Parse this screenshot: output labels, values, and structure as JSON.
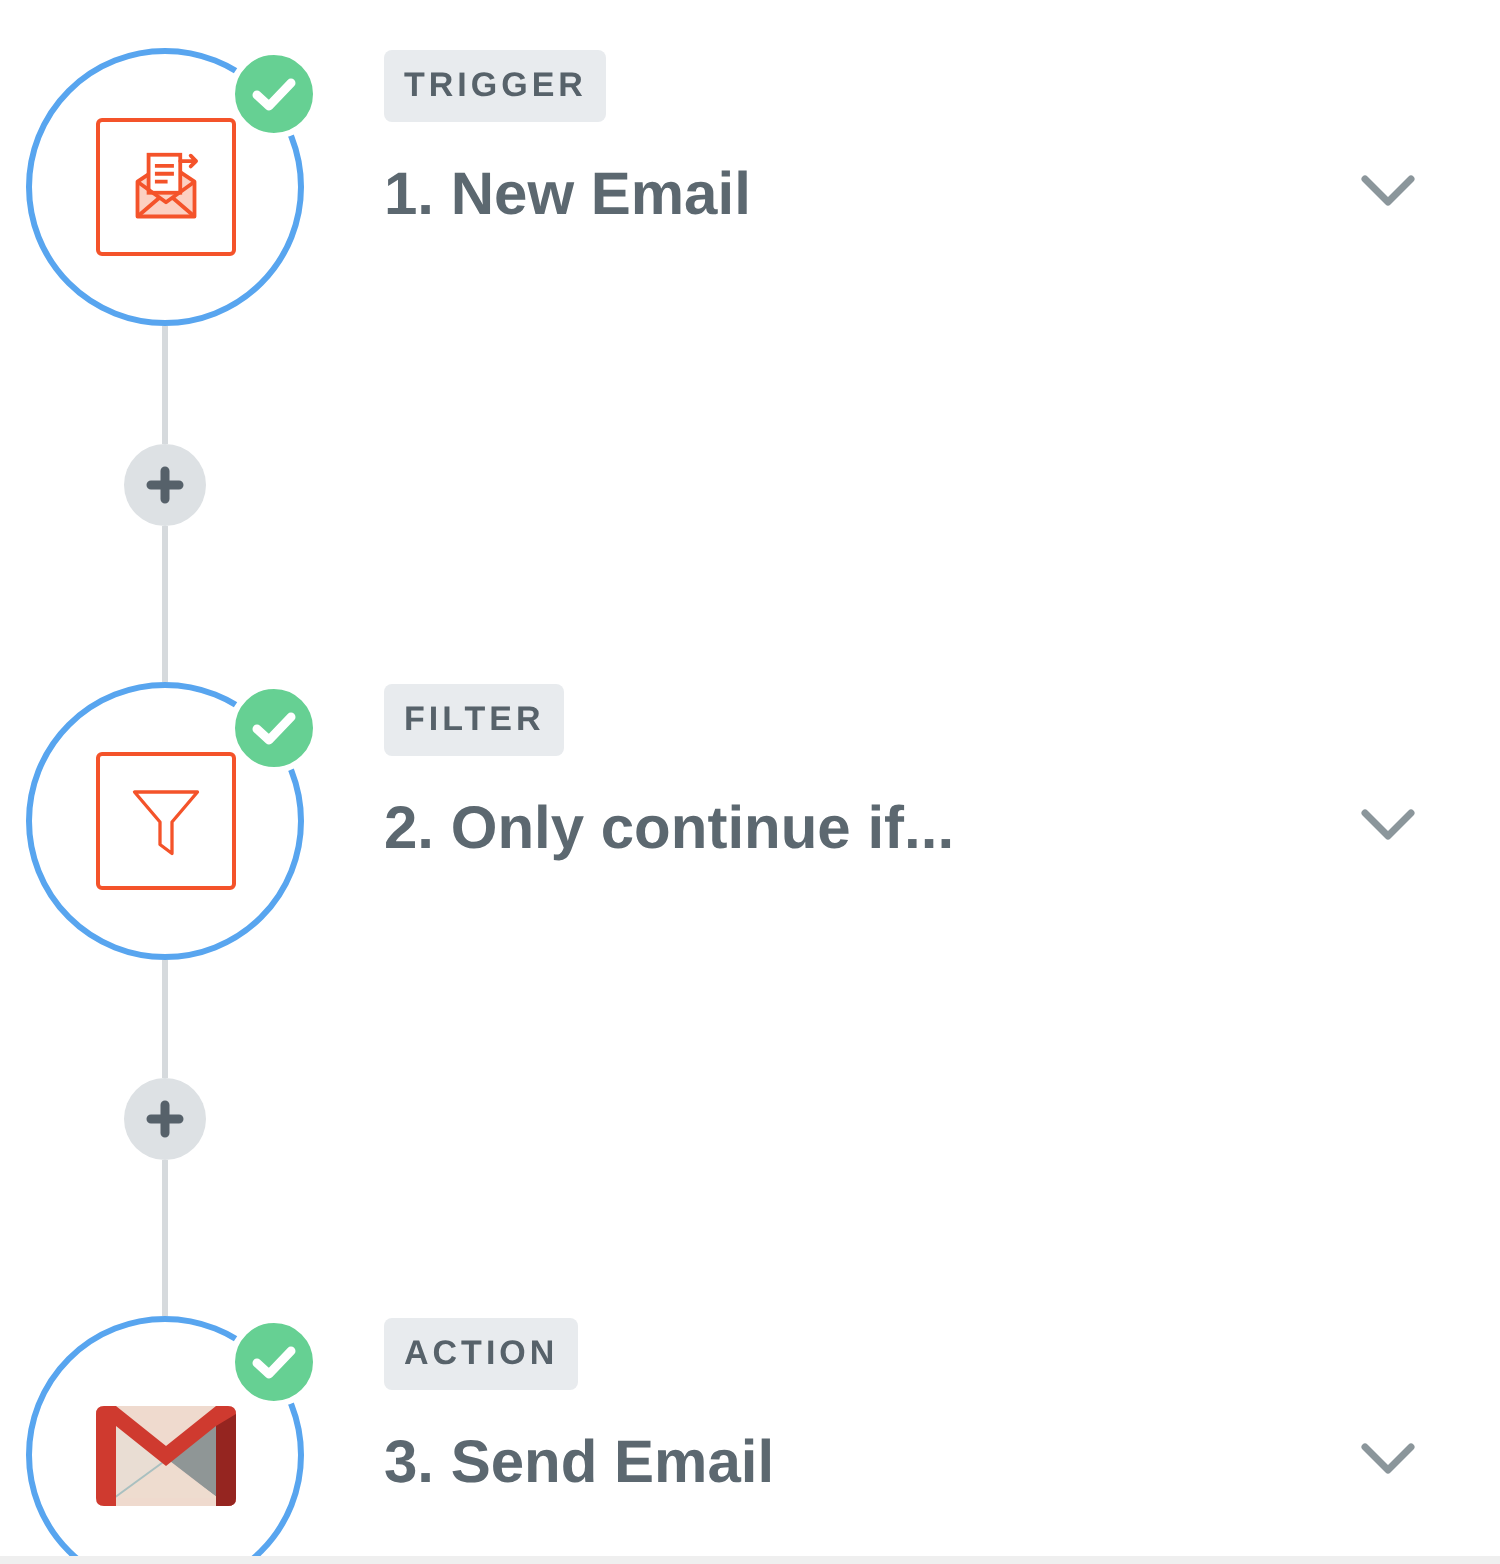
{
  "steps": [
    {
      "kind": "inbox",
      "badge": "TRIGGER",
      "title": "1. New Email",
      "complete": true
    },
    {
      "kind": "filter",
      "badge": "FILTER",
      "title": "2. Only continue if...",
      "complete": true
    },
    {
      "kind": "mail",
      "badge": "ACTION",
      "title": "3. Send Email",
      "complete": true
    }
  ]
}
